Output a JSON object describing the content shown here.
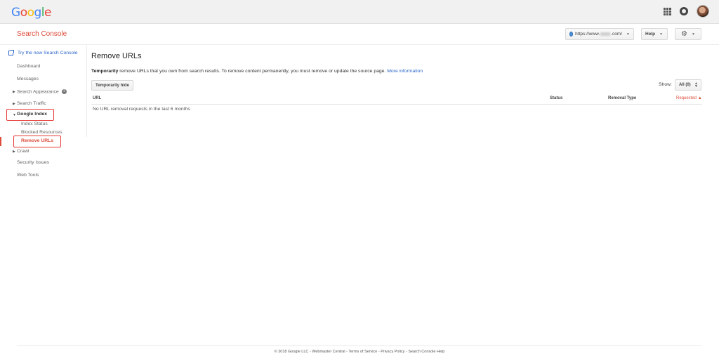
{
  "topbar": {
    "logo_letters": [
      {
        "char": "G",
        "color": "#4285f4"
      },
      {
        "char": "o",
        "color": "#ea4335"
      },
      {
        "char": "o",
        "color": "#fbbc05"
      },
      {
        "char": "g",
        "color": "#4285f4"
      },
      {
        "char": "l",
        "color": "#34a853"
      },
      {
        "char": "e",
        "color": "#ea4335"
      }
    ],
    "icons": [
      "apps-icon",
      "notifications-icon",
      "account-avatar"
    ]
  },
  "header": {
    "product_title": "Search Console",
    "site_prefix": "https://www.",
    "site_suffix": ".com/",
    "help_label": "Help",
    "settings_icon": "gear-icon"
  },
  "sidebar": {
    "try_new": "Try the new Search Console",
    "dashboard": "Dashboard",
    "messages": "Messages",
    "search_appearance": "Search Appearance",
    "search_traffic": "Search Traffic",
    "google_index": "Google Index",
    "index_status": "Index Status",
    "blocked_resources": "Blocked Resources",
    "remove_urls": "Remove URLs",
    "crawl": "Crawl",
    "security_issues": "Security Issues",
    "web_tools": "Web Tools"
  },
  "main": {
    "title": "Remove URLs",
    "desc_bold": "Temporarily",
    "desc_text": " remove URLs that you own from search results. To remove content permanently, you must remove or update the source page. ",
    "desc_link": "More information",
    "temp_hide_label": "Temporarily hide",
    "show_label": "Show:",
    "show_value": "All (0)",
    "columns": {
      "url": "URL",
      "status": "Status",
      "removal_type": "Removal Type",
      "requested": "Requested ▲"
    },
    "empty_message": "No URL removal requests in the last 6 months"
  },
  "footer": {
    "copyright": "© 2018 Google LLC",
    "links": [
      "Webmaster Central",
      "Terms of Service",
      "Privacy Policy",
      "Search Console Help"
    ],
    "separator": " - "
  },
  "colors": {
    "accent_red": "#dd4b39",
    "link_blue": "#2a65c8",
    "highlight_box": "#e53935"
  }
}
